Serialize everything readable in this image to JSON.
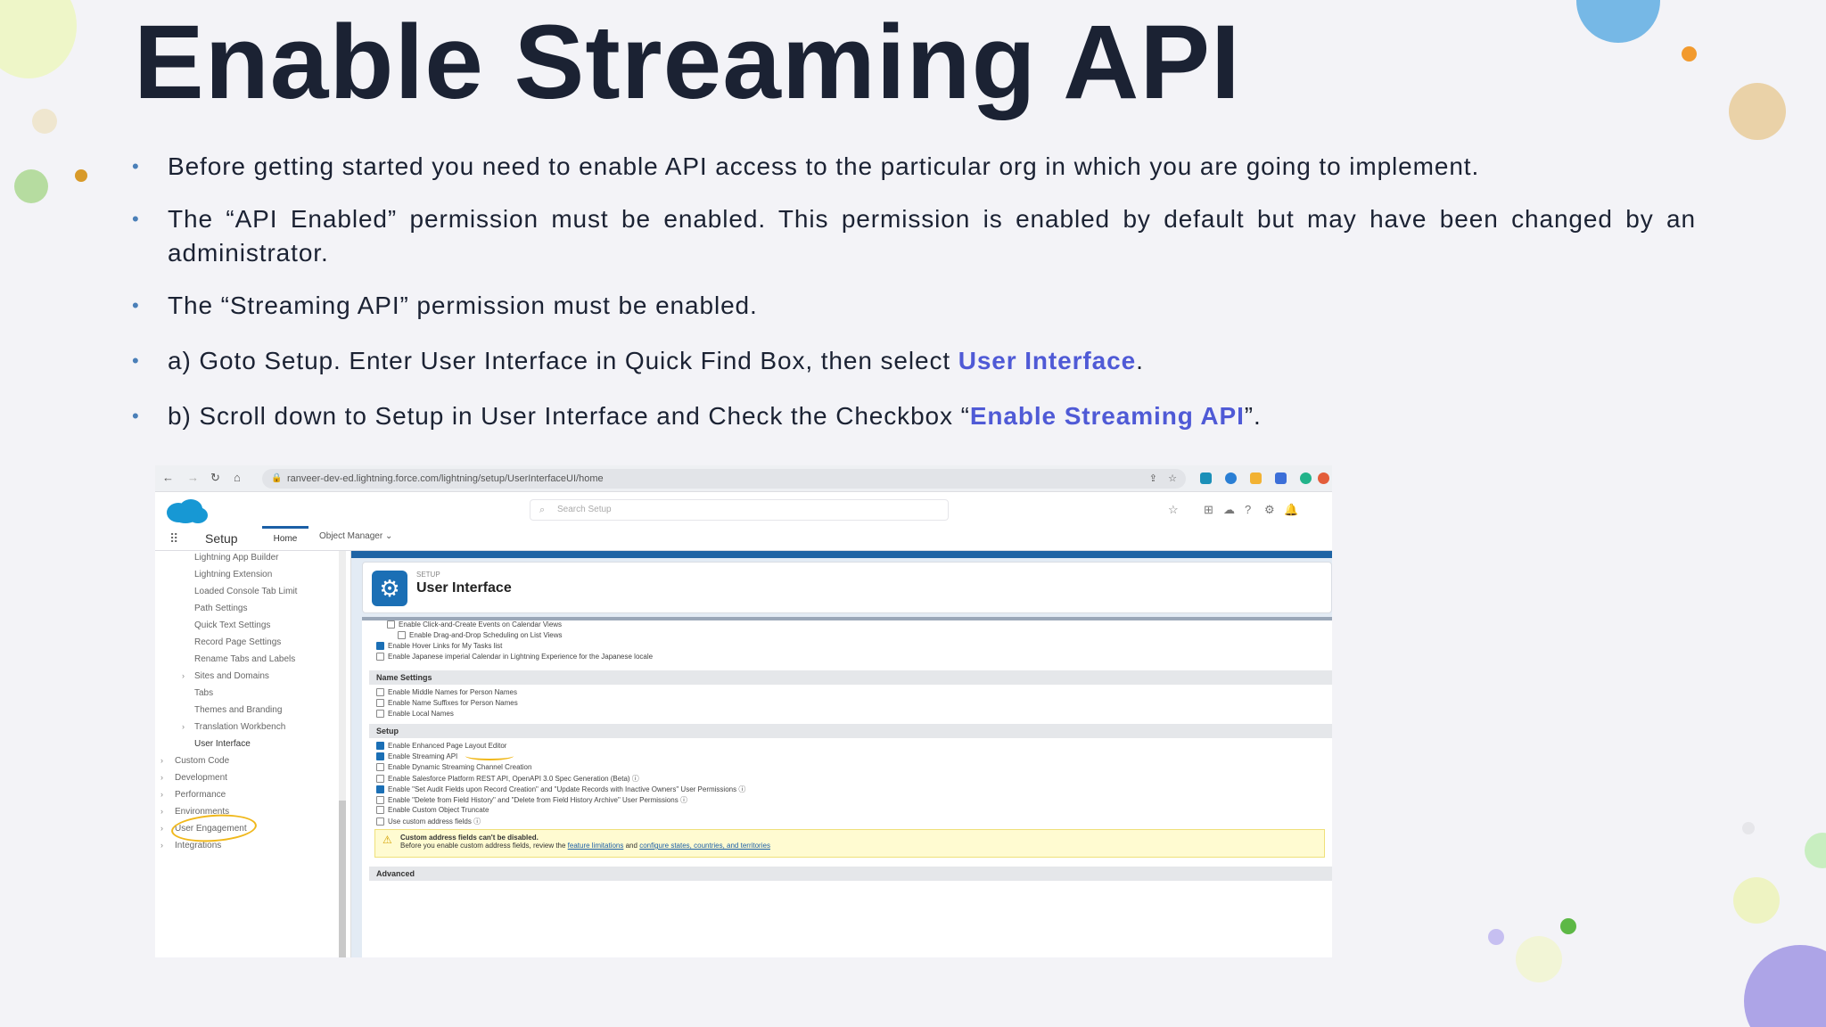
{
  "slide": {
    "title": "Enable Streaming API",
    "bullets": [
      {
        "text": "Before getting started you need to enable API access to the particular org in which you are going to implement."
      },
      {
        "text": "The “API Enabled” permission must be enabled. This permission is enabled by default but may have been changed by an administrator."
      },
      {
        "text": "The “Streaming API” permission must be enabled."
      },
      {
        "pre": "a) Goto Setup. Enter User Interface in Quick Find Box, then select ",
        "highlight": "User Interface",
        "post": "."
      },
      {
        "pre": "b) Scroll down to Setup in User Interface and Check the Checkbox “",
        "highlight": "Enable Streaming API",
        "post": "”."
      }
    ]
  },
  "screenshot": {
    "url": "ranveer-dev-ed.lightning.force.com/lightning/setup/UserInterfaceUI/home",
    "search_placeholder": "Search Setup",
    "app_name": "Setup",
    "tabs": {
      "home": "Home",
      "object_manager": "Object Manager"
    },
    "sidebar_items": [
      "Lightning App Builder",
      "Lightning Extension",
      "Loaded Console Tab Limit",
      "Path Settings",
      "Quick Text Settings",
      "Record Page Settings",
      "Rename Tabs and Labels",
      "Sites and Domains",
      "Tabs",
      "Themes and Branding",
      "Translation Workbench",
      "User Interface",
      "Custom Code",
      "Development",
      "Performance",
      "Environments",
      "User Engagement",
      "Integrations"
    ],
    "page_eyebrow": "SETUP",
    "page_title": "User Interface",
    "top_options": [
      {
        "label": "Enable Click-and-Create Events on Calendar Views",
        "checked": false
      },
      {
        "label": "Enable Drag-and-Drop Scheduling on List Views",
        "checked": false
      },
      {
        "label": "Enable Hover Links for My Tasks list",
        "checked": true
      },
      {
        "label": "Enable Japanese imperial Calendar in Lightning Experience for the Japanese locale",
        "checked": false
      }
    ],
    "name_settings_header": "Name Settings",
    "name_options": [
      {
        "label": "Enable Middle Names for Person Names",
        "checked": false
      },
      {
        "label": "Enable Name Suffixes for Person Names",
        "checked": false
      },
      {
        "label": "Enable Local Names",
        "checked": false
      }
    ],
    "setup_header": "Setup",
    "setup_options": [
      {
        "label": "Enable Enhanced Page Layout Editor",
        "checked": true
      },
      {
        "label": "Enable Streaming API",
        "checked": true
      },
      {
        "label": "Enable Dynamic Streaming Channel Creation",
        "checked": false
      },
      {
        "label": "Enable Salesforce Platform REST API, OpenAPI 3.0 Spec Generation (Beta)",
        "checked": false
      },
      {
        "label": "Enable \"Set Audit Fields upon Record Creation\" and \"Update Records with Inactive Owners\" User Permissions",
        "checked": true
      },
      {
        "label": "Enable \"Delete from Field History\" and \"Delete from Field History Archive\" User Permissions",
        "checked": false
      },
      {
        "label": "Enable Custom Object Truncate",
        "checked": false
      },
      {
        "label": "Use custom address fields",
        "checked": false
      }
    ],
    "warning_title": "Custom address fields can't be disabled.",
    "warning_text": "Before you enable custom address fields, review the",
    "warning_link1": "feature limitations",
    "warning_and": "and",
    "warning_link2": "configure states, countries, and territories",
    "advanced_header": "Advanced"
  },
  "colors": {
    "title": "#1b2233",
    "highlight": "#4f5ad6",
    "bullet": "#4a7fb8"
  }
}
